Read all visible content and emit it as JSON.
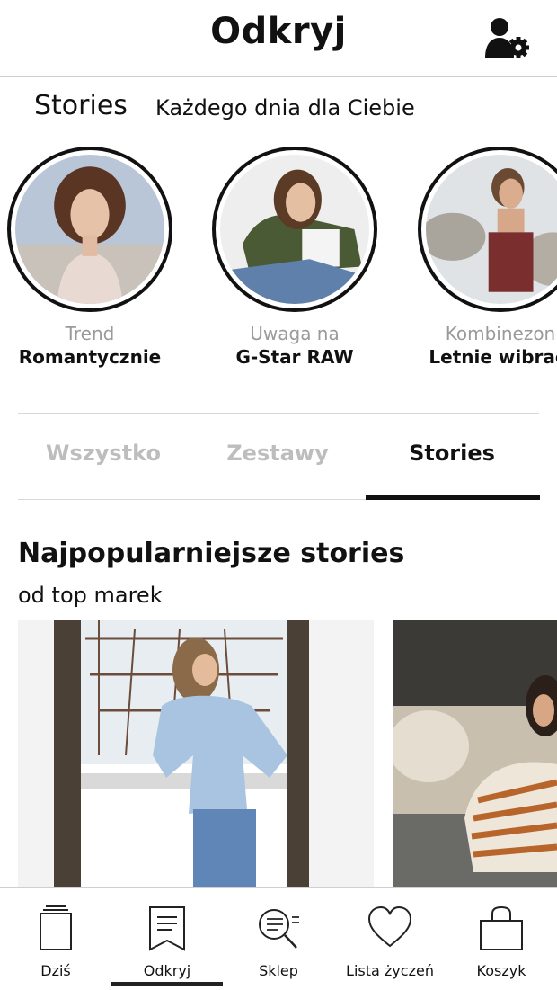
{
  "header": {
    "title": "Odkryj",
    "profile_icon": "user-settings-icon"
  },
  "stories_section": {
    "title": "Stories",
    "subtitle": "Każdego dnia dla Ciebie",
    "items": [
      {
        "kicker": "Trend",
        "name": "Romantycznie"
      },
      {
        "kicker": "Uwaga na",
        "name": "G-Star RAW"
      },
      {
        "kicker": "Kombinezon",
        "name": "Letnie wibracj"
      }
    ]
  },
  "tabs": [
    {
      "label": "Wszystko",
      "active": false
    },
    {
      "label": "Zestawy",
      "active": false
    },
    {
      "label": "Stories",
      "active": true
    }
  ],
  "popular": {
    "title": "Najpopularniejsze stories",
    "subtitle": "od top marek"
  },
  "bottom_nav": [
    {
      "label": "Dziś",
      "icon": "today-stack-icon",
      "active": false
    },
    {
      "label": "Odkryj",
      "icon": "bookmark-icon",
      "active": true
    },
    {
      "label": "Sklep",
      "icon": "search-list-icon",
      "active": false
    },
    {
      "label": "Lista życzeń",
      "icon": "heart-icon",
      "active": false
    },
    {
      "label": "Koszyk",
      "icon": "shopping-bag-icon",
      "active": false
    }
  ],
  "colors": {
    "accent": "#111111",
    "muted_text": "#9a9a9a",
    "inactive_tab": "#bdbdbd",
    "divider": "#d8d8d8"
  }
}
